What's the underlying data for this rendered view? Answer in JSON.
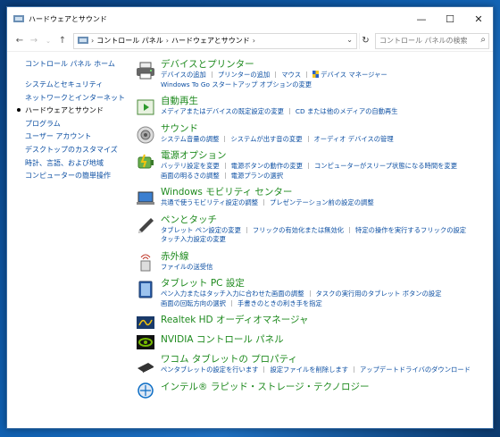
{
  "window": {
    "title": "ハードウェアとサウンド",
    "minimize": "—",
    "maximize": "☐",
    "close": "✕"
  },
  "address": {
    "crumbs": [
      "コントロール パネル",
      "ハードウェアとサウンド"
    ],
    "search_placeholder": "コントロール パネルの検索"
  },
  "sidebar": {
    "home": "コントロール パネル ホーム",
    "items": [
      "システムとセキュリティ",
      "ネットワークとインターネット",
      "ハードウェアとサウンド",
      "プログラム",
      "ユーザー アカウント",
      "デスクトップのカスタマイズ",
      "時計、言語、および地域",
      "コンピューターの簡単操作"
    ],
    "active_index": 2
  },
  "categories": [
    {
      "title": "デバイスとプリンター",
      "links": [
        [
          "デバイスの追加",
          "プリンターの追加",
          "マウス",
          "デバイス マネージャー"
        ],
        [
          "Windows To Go スタートアップ オプションの変更"
        ]
      ]
    },
    {
      "title": "自動再生",
      "links": [
        [
          "メディアまたはデバイスの既定設定の変更",
          "CD または他のメディアの自動再生"
        ]
      ]
    },
    {
      "title": "サウンド",
      "links": [
        [
          "システム音量の調整",
          "システムが出す音の変更",
          "オーディオ デバイスの管理"
        ]
      ]
    },
    {
      "title": "電源オプション",
      "links": [
        [
          "バッテリ設定を変更",
          "電源ボタンの動作の変更",
          "コンピューターがスリープ状態になる時間を変更"
        ],
        [
          "画面の明るさの調整",
          "電源プランの選択"
        ]
      ]
    },
    {
      "title": "Windows モビリティ センター",
      "links": [
        [
          "共通で使うモビリティ設定の調整",
          "プレゼンテーション前の設定の調整"
        ]
      ]
    },
    {
      "title": "ペンとタッチ",
      "links": [
        [
          "タブレット ペン設定の変更",
          "フリックの有効化または無効化",
          "特定の操作を実行するフリックの設定"
        ],
        [
          "タッチ入力設定の変更"
        ]
      ]
    },
    {
      "title": "赤外線",
      "links": [
        [
          "ファイルの送受信"
        ]
      ]
    },
    {
      "title": "タブレット PC 設定",
      "links": [
        [
          "ペン入力またはタッチ入力に合わせた画面の調整",
          "タスクの実行用のタブレット ボタンの設定"
        ],
        [
          "画面の回転方向の選択",
          "手書きのときの利き手を指定"
        ]
      ]
    },
    {
      "title": "Realtek HD オーディオマネージャ",
      "links": []
    },
    {
      "title": "NVIDIA コントロール パネル",
      "links": []
    },
    {
      "title": "ワコム タブレットの プロパティ",
      "links": [
        [
          "ペンタブレットの設定を行います",
          "設定ファイルを削除します",
          "アップデートドライバのダウンロード"
        ]
      ]
    },
    {
      "title": "インテル® ラピッド・ストレージ・テクノロジー",
      "links": []
    }
  ],
  "icons": [
    "printer-icon",
    "autoplay-icon",
    "speaker-icon",
    "power-icon",
    "mobility-icon",
    "pen-icon",
    "infrared-icon",
    "tablet-icon",
    "realtek-icon",
    "nvidia-icon",
    "wacom-icon",
    "intel-icon"
  ]
}
